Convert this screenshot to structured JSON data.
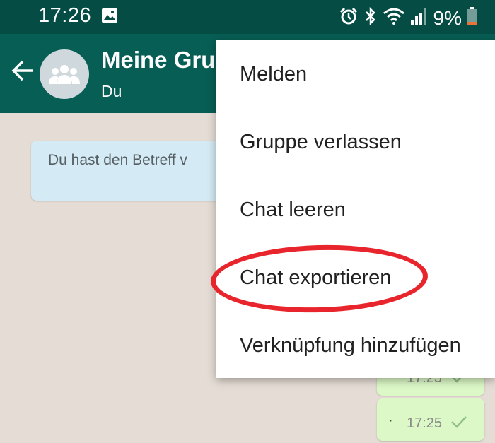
{
  "status_bar": {
    "time": "17:26",
    "battery": "9%",
    "icons": [
      "image-icon",
      "alarm-icon",
      "bluetooth-icon",
      "wifi-icon",
      "signal-icon",
      "battery-icon"
    ],
    "battery_color": "#e8743b"
  },
  "header": {
    "title": "Meine Gru",
    "subtitle": "Du",
    "bar_color": "#075e54"
  },
  "chat": {
    "system_message": "Du hast den Betreff v",
    "messages": [
      {
        "time": "17:25",
        "dot": "·"
      },
      {
        "time": "17:25",
        "dot": "·"
      }
    ]
  },
  "menu": {
    "items": [
      {
        "label": "Melden"
      },
      {
        "label": "Gruppe verlassen"
      },
      {
        "label": "Chat leeren"
      },
      {
        "label": "Chat exportieren",
        "highlighted": true
      },
      {
        "label": "Verknüpfung hinzufügen"
      }
    ],
    "highlight_color": "#e8252c"
  }
}
